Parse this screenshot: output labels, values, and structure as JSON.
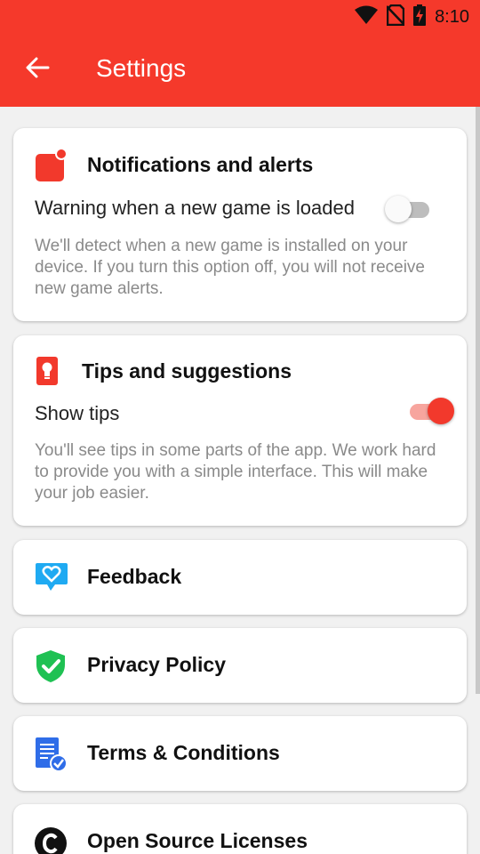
{
  "status_bar": {
    "time": "8:10",
    "icons": [
      "wifi-icon",
      "no-sim-icon",
      "battery-charging-icon"
    ]
  },
  "app_bar": {
    "title": "Settings",
    "back_icon": "arrow-back-icon",
    "color": "#f5392b"
  },
  "notifications_card": {
    "title": "Notifications and alerts",
    "icon": "notification-badge-icon",
    "option_label": "Warning when a new game is loaded",
    "toggle_on": false,
    "description": "We'll detect when a new game is installed on your device. If you turn this option off, you will not receive new game alerts."
  },
  "tips_card": {
    "title": "Tips and suggestions",
    "icon": "lightbulb-icon",
    "option_label": "Show tips",
    "toggle_on": true,
    "description": "You'll see tips in some parts of the app. We work hard to provide you with a simple interface. This will make your job easier."
  },
  "links": [
    {
      "label": "Feedback",
      "icon": "feedback-heart-icon"
    },
    {
      "label": "Privacy Policy",
      "icon": "shield-check-icon"
    },
    {
      "label": "Terms & Conditions",
      "icon": "document-check-icon"
    },
    {
      "label": "Open Source Licenses",
      "icon": "copyright-icon"
    }
  ],
  "colors": {
    "accent": "#f2392c",
    "toggle_track_on": "#f7a59e",
    "description_text": "#8a8a8a"
  }
}
